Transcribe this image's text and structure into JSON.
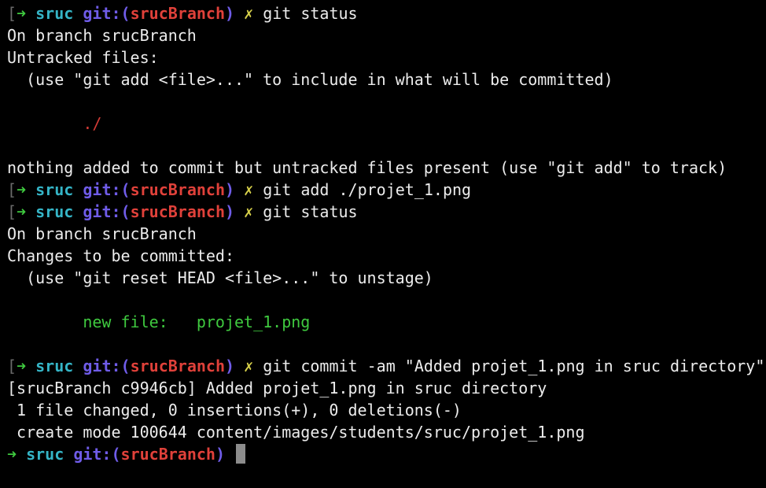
{
  "prompt": {
    "open_bracket": "[",
    "arrow": "➜",
    "user": "sruc",
    "git_label": "git:",
    "paren_open": "(",
    "branch": "srucBranch",
    "paren_close": ")",
    "dirty_mark": "✗"
  },
  "lines": [
    {
      "type": "prompt",
      "bracket": true,
      "command": "git status"
    },
    {
      "type": "out",
      "text": "On branch srucBranch"
    },
    {
      "type": "out",
      "text": "Untracked files:"
    },
    {
      "type": "out",
      "text": "  (use \"git add <file>...\" to include in what will be committed)"
    },
    {
      "type": "blank"
    },
    {
      "type": "out_red",
      "text": "        ./"
    },
    {
      "type": "blank"
    },
    {
      "type": "out",
      "text": "nothing added to commit but untracked files present (use \"git add\" to track)"
    },
    {
      "type": "prompt",
      "bracket": true,
      "command": "git add ./projet_1.png"
    },
    {
      "type": "prompt",
      "bracket": true,
      "command": "git status"
    },
    {
      "type": "out",
      "text": "On branch srucBranch"
    },
    {
      "type": "out",
      "text": "Changes to be committed:"
    },
    {
      "type": "out",
      "text": "  (use \"git reset HEAD <file>...\" to unstage)"
    },
    {
      "type": "blank"
    },
    {
      "type": "out_green",
      "text": "        new file:   projet_1.png"
    },
    {
      "type": "blank"
    },
    {
      "type": "prompt",
      "bracket": true,
      "command": "git commit -am \"Added projet_1.png in sruc directory\""
    },
    {
      "type": "out",
      "text": "[srucBranch c9946cb] Added projet_1.png in sruc directory"
    },
    {
      "type": "out",
      "text": " 1 file changed, 0 insertions(+), 0 deletions(-)"
    },
    {
      "type": "out",
      "text": " create mode 100644 content/images/students/sruc/projet_1.png"
    },
    {
      "type": "prompt_active",
      "bracket": false,
      "command": ""
    }
  ]
}
